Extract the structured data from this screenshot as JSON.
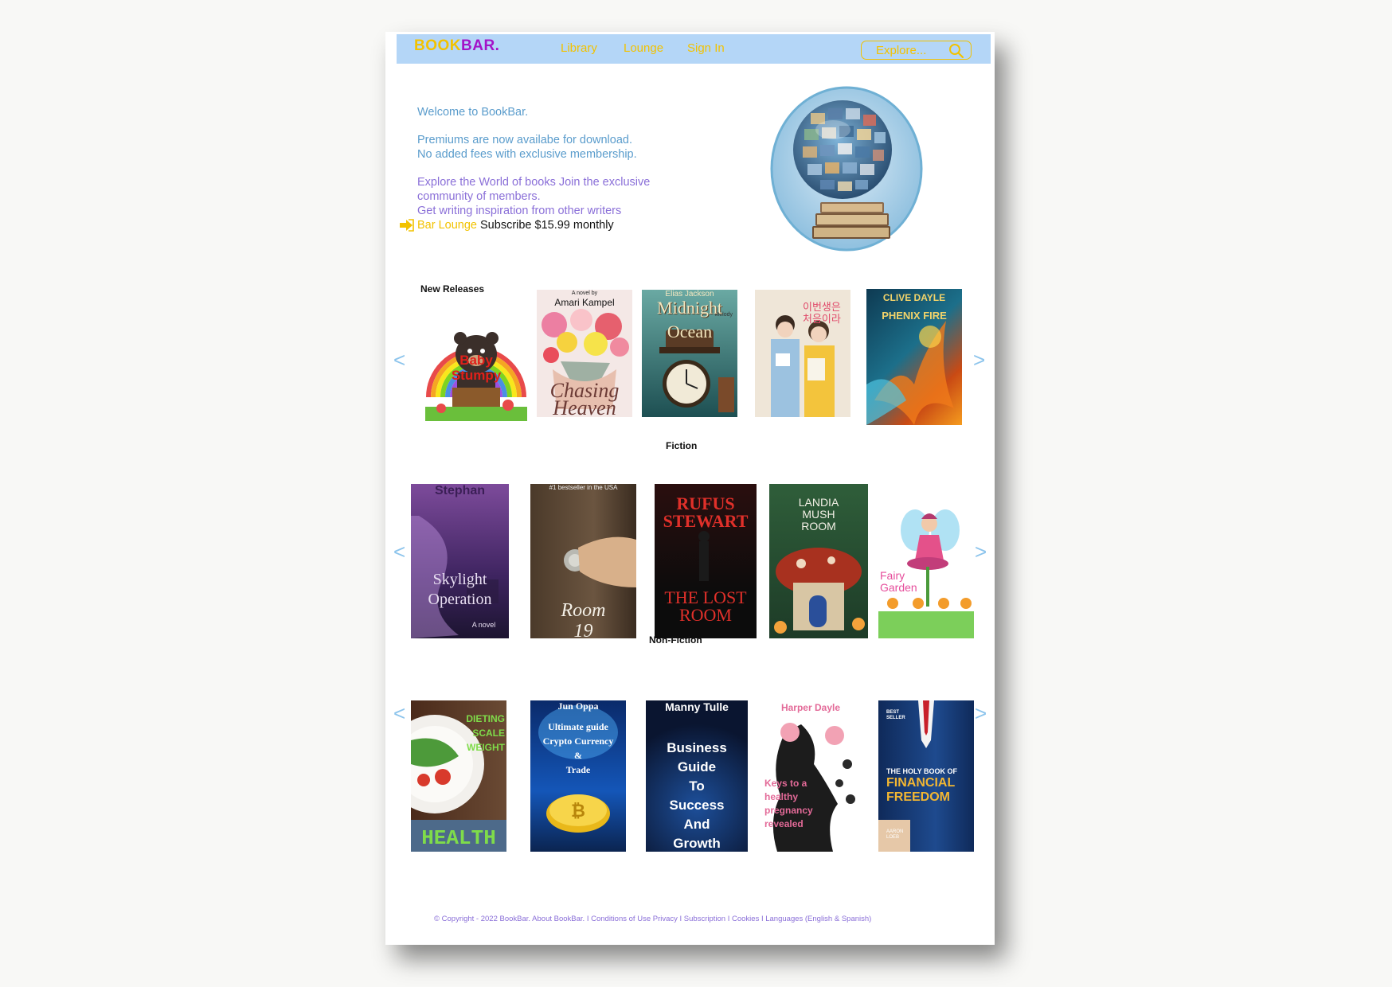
{
  "nav": {
    "logo_book": "BOOK",
    "logo_bar": "BAR.",
    "links": [
      "Library",
      "Lounge",
      "Sign In"
    ],
    "search_placeholder": "Explore..."
  },
  "hero": {
    "welcome": "Welcome to BookBar.",
    "premium_line1": "Premiums are now availabe for download.",
    "premium_line2": "No added fees with exclusive membership.",
    "explore_line1": "Explore the World of books Join the exclusive",
    "explore_line2": "community of members.",
    "explore_line3": "Get writing inspiration from other writers",
    "lounge_link": "Bar Lounge",
    "subscribe_text": " Subscribe $15.99 monthly"
  },
  "sections": {
    "new_releases": {
      "title": "New Releases",
      "books": [
        {
          "line1": "Baby",
          "line2": "Stumpy"
        },
        {
          "top": "A novel by",
          "author": "Amari Kampel",
          "line1": "Chasing",
          "line2": "Heaven"
        },
        {
          "top": "Elias Jackson",
          "line1": "Midnight",
          "line2": "Ocean",
          "extra": "Melody"
        },
        {
          "korean": "이번생은 처음이라"
        },
        {
          "author": "CLIVE DAYLE",
          "line1": "PHENIX FIRE"
        }
      ]
    },
    "fiction": {
      "title": "Fiction",
      "books": [
        {
          "author": "Stephan",
          "line1": "Skylight",
          "line2": "Operation",
          "line3": "A novel"
        },
        {
          "top": "#1 bestseller in the USA",
          "line1": "Room",
          "line2": "19"
        },
        {
          "author": "RUFUS STEWART",
          "line1": "THE LOST",
          "line2": "ROOM"
        },
        {
          "line1": "LANDIA",
          "line2": "MUSH",
          "line3": "ROOM"
        },
        {
          "line1": "Fairy",
          "line2": "Garden"
        }
      ]
    },
    "nonfiction": {
      "title": "Non-Fiction",
      "books": [
        {
          "line1": "DIETING",
          "line2": "SCALE",
          "line3": "WEIGHT",
          "bottom": "HEALTH"
        },
        {
          "author": "Jun Oppa",
          "line1": "Ultimate guide",
          "line2": "Crypto Currency",
          "line3": "&",
          "line4": "Trade"
        },
        {
          "author": "Manny Tulle",
          "line1": "Business",
          "line2": "Guide",
          "line3": "To",
          "line4": "Success",
          "line5": "And",
          "line6": "Growth"
        },
        {
          "author": "Harper Dayle",
          "line1": "Keys to a",
          "line2": "healthy",
          "line3": "pregnancy",
          "line4": "revealed"
        },
        {
          "top": "BEST SELLER",
          "line1": "THE HOLY BOOK OF",
          "line2": "FINANCIAL",
          "line3": "FREEDOM",
          "author": "AARON LOEB"
        }
      ]
    }
  },
  "arrows": {
    "prev": "<",
    "next": ">"
  },
  "footer": "© Copyright - 2022 BookBar. About BookBar. I Conditions of Use Privacy I Subscription I Cookies I Languages (English & Spanish)",
  "colors": {
    "accent_yellow": "#f2c200",
    "accent_purple": "#a313c8",
    "nav_bg": "#b4d6f7",
    "text_blue": "#5a9ccc",
    "text_purple": "#8a6fd8",
    "arrow_blue": "#8cc4ec"
  }
}
